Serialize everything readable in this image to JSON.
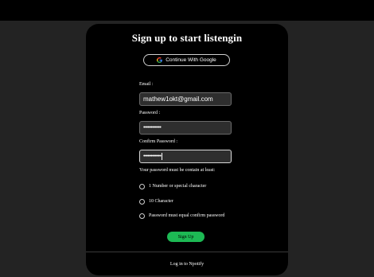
{
  "form": {
    "title": "Sign up to start listengin",
    "google_button_label": "Continue With Google",
    "email_label": "Email :",
    "email_value": "mathew1okt@gmail.com",
    "password_label": "Password :",
    "password_value": "••••••••••••",
    "confirm_label": "Confirm Password :",
    "confirm_value": "••••••••••••",
    "rules_title": "Your password must be contain at least:",
    "rules": [
      "1 Number or special character",
      "10 Character",
      "Password must equal confirm password"
    ],
    "signup_label": "Sign Up",
    "login_link": "Log in to Npotify"
  },
  "colors": {
    "accent": "#1db954",
    "card_bg": "#000000",
    "page_bg": "#232323",
    "field_bg": "#2e2e2e"
  },
  "icons": {
    "google": "google-icon",
    "radio": "radio-icon"
  }
}
